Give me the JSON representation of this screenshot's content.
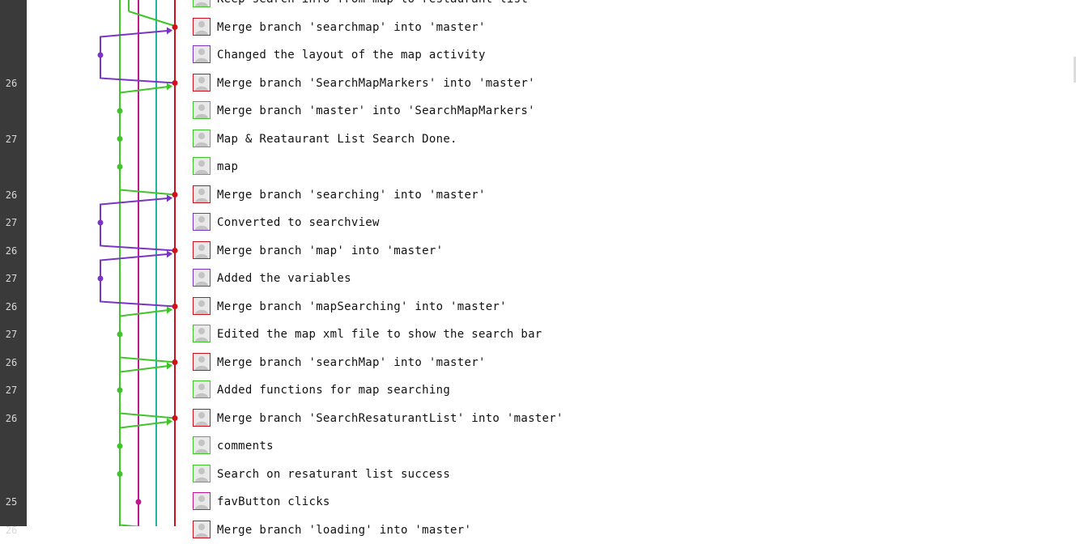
{
  "colors": {
    "gutter": "#3a3a3a",
    "red": "#d0111c",
    "green": "#3fc42a",
    "purple": "#7a35c4",
    "teal": "#1ab8a0",
    "magenta": "#c0168e"
  },
  "commits": [
    {
      "week": "",
      "message": "Keep search info from map to restaurant list",
      "avatar": "green"
    },
    {
      "week": "",
      "message": "Merge branch 'searchmap' into 'master'",
      "avatar": "red"
    },
    {
      "week": "",
      "message": "Changed the layout of the map activity",
      "avatar": "purple"
    },
    {
      "week": "26",
      "message": "Merge branch 'SearchMapMarkers' into 'master'",
      "avatar": "red"
    },
    {
      "week": "",
      "message": "Merge branch 'master' into 'SearchMapMarkers'",
      "avatar": "green"
    },
    {
      "week": "27",
      "message": "Map & Reataurant List Search Done.",
      "avatar": "green"
    },
    {
      "week": "",
      "message": "map",
      "avatar": "green"
    },
    {
      "week": "26",
      "message": "Merge branch 'searching' into 'master'",
      "avatar": "red"
    },
    {
      "week": "27",
      "message": "Converted to searchview",
      "avatar": "purple"
    },
    {
      "week": "26",
      "message": "Merge branch 'map' into 'master'",
      "avatar": "red"
    },
    {
      "week": "27",
      "message": "Added the variables",
      "avatar": "purple"
    },
    {
      "week": "26",
      "message": "Merge branch 'mapSearching' into 'master'",
      "avatar": "red"
    },
    {
      "week": "27",
      "message": "Edited the map xml file to show the search bar",
      "avatar": "green"
    },
    {
      "week": "26",
      "message": "Merge branch 'searchMap' into 'master'",
      "avatar": "red"
    },
    {
      "week": "27",
      "message": "Added functions for map searching",
      "avatar": "green"
    },
    {
      "week": "26",
      "message": "Merge branch 'SearchResaturantList' into 'master'",
      "avatar": "red"
    },
    {
      "week": "",
      "message": "comments",
      "avatar": "green"
    },
    {
      "week": "",
      "message": "Search on resaturant list success",
      "avatar": "green"
    },
    {
      "week": "25",
      "message": "favButton clicks",
      "avatar": "magenta"
    },
    {
      "week": "26",
      "message": "Merge branch 'loading' into 'master'",
      "avatar": "red"
    }
  ]
}
